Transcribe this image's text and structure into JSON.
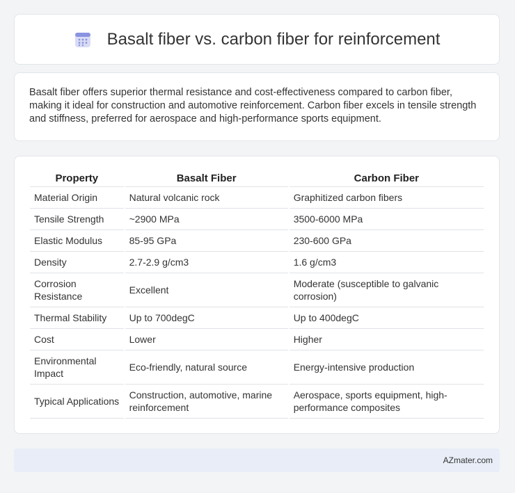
{
  "header": {
    "title": "Basalt fiber vs. carbon fiber for reinforcement",
    "icon": "calendar-icon"
  },
  "summary": {
    "text": "Basalt fiber offers superior thermal resistance and cost-effectiveness compared to carbon fiber, making it ideal for construction and automotive reinforcement. Carbon fiber excels in tensile strength and stiffness, preferred for aerospace and high-performance sports equipment."
  },
  "table": {
    "headers": [
      "Property",
      "Basalt Fiber",
      "Carbon Fiber"
    ],
    "rows": [
      [
        "Material Origin",
        "Natural volcanic rock",
        "Graphitized carbon fibers"
      ],
      [
        "Tensile Strength",
        "~2900 MPa",
        "3500-6000 MPa"
      ],
      [
        "Elastic Modulus",
        "85-95 GPa",
        "230-600 GPa"
      ],
      [
        "Density",
        "2.7-2.9 g/cm3",
        "1.6 g/cm3"
      ],
      [
        "Corrosion Resistance",
        "Excellent",
        "Moderate (susceptible to galvanic corrosion)"
      ],
      [
        "Thermal Stability",
        "Up to 700degC",
        "Up to 400degC"
      ],
      [
        "Cost",
        "Lower",
        "Higher"
      ],
      [
        "Environmental Impact",
        "Eco-friendly, natural source",
        "Energy-intensive production"
      ],
      [
        "Typical Applications",
        "Construction, automotive, marine reinforcement",
        "Aerospace, sports equipment, high-performance composites"
      ]
    ]
  },
  "footer": {
    "brand": "AZmater.com"
  }
}
